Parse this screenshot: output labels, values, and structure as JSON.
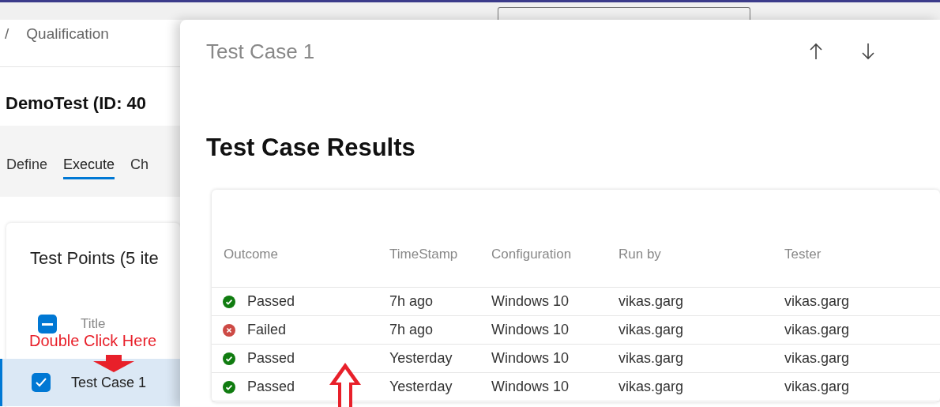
{
  "breadcrumb": {
    "separator": "/",
    "label": "Qualification"
  },
  "page_title": "DemoTest (ID: 40",
  "tabs": [
    {
      "label": "Define",
      "selected": false
    },
    {
      "label": "Execute",
      "selected": true
    },
    {
      "label": "Ch",
      "selected": false
    }
  ],
  "test_points": {
    "title": "Test Points (5 ite",
    "header_checkbox": {
      "indeterminate": true
    },
    "column": "Title",
    "rows": [
      {
        "title": "Test Case 1",
        "checked": true,
        "selected": true
      }
    ]
  },
  "annotation": {
    "label": "Double Click Here"
  },
  "panel": {
    "title": "Test Case 1",
    "section_title": "Test Case Results",
    "columns": [
      "Outcome",
      "TimeStamp",
      "Configuration",
      "Run by",
      "Tester"
    ],
    "rows": [
      {
        "kind": "passed",
        "outcome": "Passed",
        "timestamp": "7h ago",
        "configuration": "Windows 10",
        "run_by": "vikas.garg",
        "tester": "vikas.garg"
      },
      {
        "kind": "failed",
        "outcome": "Failed",
        "timestamp": "7h ago",
        "configuration": "Windows 10",
        "run_by": "vikas.garg",
        "tester": "vikas.garg"
      },
      {
        "kind": "passed",
        "outcome": "Passed",
        "timestamp": "Yesterday",
        "configuration": "Windows 10",
        "run_by": "vikas.garg",
        "tester": "vikas.garg"
      },
      {
        "kind": "passed",
        "outcome": "Passed",
        "timestamp": "Yesterday",
        "configuration": "Windows 10",
        "run_by": "vikas.garg",
        "tester": "vikas.garg"
      }
    ]
  }
}
